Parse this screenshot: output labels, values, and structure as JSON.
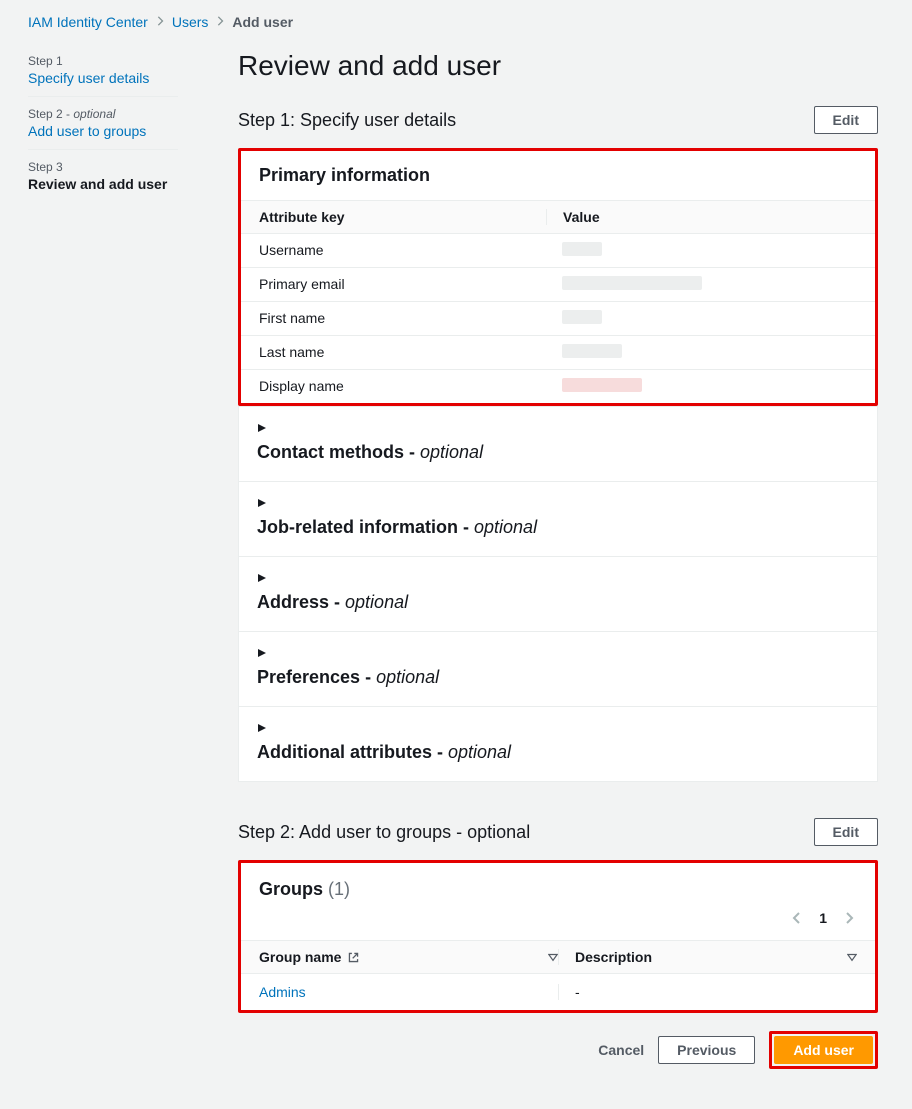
{
  "breadcrumb": {
    "root": "IAM Identity Center",
    "users": "Users",
    "current": "Add user"
  },
  "steps": {
    "s1": {
      "num": "Step 1",
      "label": "Specify user details"
    },
    "s2": {
      "num": "Step 2 -",
      "opt": "optional",
      "label": "Add user to groups"
    },
    "s3": {
      "num": "Step 3",
      "label": "Review and add user"
    }
  },
  "title": "Review and add user",
  "step1": {
    "title": "Step 1: Specify user details",
    "edit": "Edit",
    "primary_info": {
      "heading": "Primary information",
      "attr_header": "Attribute key",
      "val_header": "Value",
      "rows": {
        "username": "Username",
        "primary_email": "Primary email",
        "first_name": "First name",
        "last_name": "Last name",
        "display_name": "Display name"
      }
    },
    "sections": {
      "contact": {
        "label": "Contact methods",
        "suffix": " - ",
        "opt": "optional"
      },
      "job": {
        "label": "Job-related information",
        "suffix": " - ",
        "opt": "optional"
      },
      "address": {
        "label": "Address",
        "suffix": " - ",
        "opt": "optional"
      },
      "prefs": {
        "label": "Preferences",
        "suffix": " - ",
        "opt": "optional"
      },
      "addl": {
        "label": "Additional attributes",
        "suffix": " - ",
        "opt": "optional"
      }
    }
  },
  "step2": {
    "title": "Step 2: Add user to groups - optional",
    "edit": "Edit",
    "groups": {
      "heading": "Groups",
      "count_display": "(1)",
      "page": "1",
      "col1": "Group name",
      "col2": "Description",
      "row": {
        "name": "Admins",
        "desc": "-"
      }
    }
  },
  "footer": {
    "cancel": "Cancel",
    "previous": "Previous",
    "submit": "Add user"
  }
}
